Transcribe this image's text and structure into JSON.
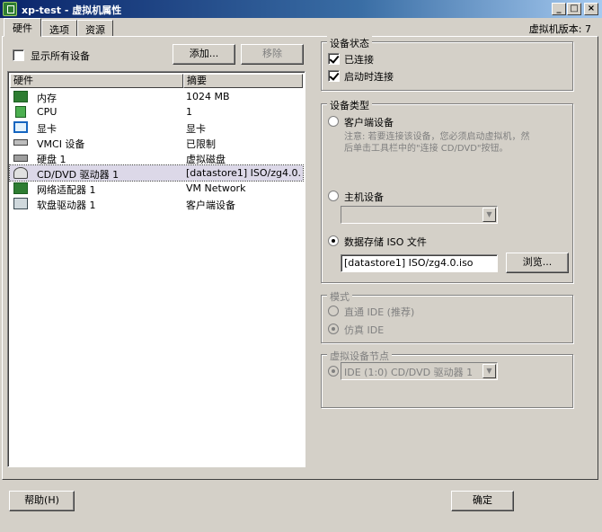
{
  "window": {
    "title": "xp-test - 虚拟机属性",
    "min": "_",
    "max": "□",
    "close": "×"
  },
  "tabs": [
    {
      "label": "硬件",
      "active": true
    },
    {
      "label": "选项"
    },
    {
      "label": "资源"
    }
  ],
  "version_label": "虚拟机版本: 7",
  "show_all_devices": {
    "label": "显示所有设备",
    "checked": false
  },
  "buttons": {
    "add": "添加...",
    "remove": "移除",
    "browse": "浏览...",
    "help": "帮助(H)",
    "ok": "确定"
  },
  "hardware_table": {
    "columns": [
      "硬件",
      "摘要"
    ],
    "rows": [
      {
        "icon": "memory-icon",
        "name": "内存",
        "summary": "1024 MB"
      },
      {
        "icon": "cpu-icon",
        "name": "CPU",
        "summary": "1"
      },
      {
        "icon": "display-icon",
        "name": "显卡",
        "summary": "显卡"
      },
      {
        "icon": "vmci-icon",
        "name": "VMCI 设备",
        "summary": "已限制"
      },
      {
        "icon": "hard-disk-icon",
        "name": "硬盘 1",
        "summary": "虚拟磁盘"
      },
      {
        "icon": "cd-dvd-icon",
        "name": "CD/DVD 驱动器 1",
        "summary": "[datastore1] ISO/zg4.0....",
        "selected": true
      },
      {
        "icon": "network-adapter-icon",
        "name": "网络适配器 1",
        "summary": "VM Network"
      },
      {
        "icon": "floppy-drive-icon",
        "name": "软盘驱动器 1",
        "summary": "客户端设备"
      }
    ]
  },
  "device_status": {
    "title": "设备状态",
    "connected": {
      "label": "已连接",
      "checked": true
    },
    "connect_at_power_on": {
      "label": "启动时连接",
      "checked": true
    }
  },
  "device_type": {
    "title": "设备类型",
    "client_device": {
      "label": "客户端设备",
      "selected": false
    },
    "client_note_line1": "注意: 若要连接该设备，您必须启动虚拟机，然",
    "client_note_line2": "后单击工具栏中的\"连接 CD/DVD\"按钮。",
    "host_device": {
      "label": "主机设备",
      "selected": false,
      "value": ""
    },
    "datastore_iso": {
      "label": "数据存储 ISO 文件",
      "selected": true,
      "value": "[datastore1] ISO/zg4.0.iso"
    }
  },
  "mode": {
    "title": "模式",
    "passthrough": {
      "label": "直通 IDE (推荐)",
      "selected": false
    },
    "emulate": {
      "label": "仿真 IDE",
      "selected": true
    }
  },
  "virtual_device_node": {
    "title": "虚拟设备节点",
    "value": "IDE (1:0) CD/DVD 驱动器 1"
  },
  "colors": {
    "title_start": "#0a246a",
    "title_end": "#a6caf0",
    "face": "#d4d0c8"
  }
}
